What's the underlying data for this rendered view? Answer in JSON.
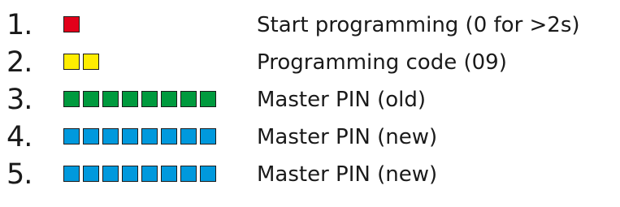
{
  "steps": [
    {
      "number": "1.",
      "label": "Start programming (0 for >2s)",
      "key_count": 1,
      "key_color": "#e2001a"
    },
    {
      "number": "2.",
      "label": "Programming code (09)",
      "key_count": 2,
      "key_color": "#ffed00"
    },
    {
      "number": "3.",
      "label": "Master PIN (old)",
      "key_count": 8,
      "key_color": "#009a3e"
    },
    {
      "number": "4.",
      "label": "Master PIN (new)",
      "key_count": 8,
      "key_color": "#0099dd"
    },
    {
      "number": "5.",
      "label": "Master PIN (new)",
      "key_count": 8,
      "key_color": "#0099dd"
    }
  ]
}
